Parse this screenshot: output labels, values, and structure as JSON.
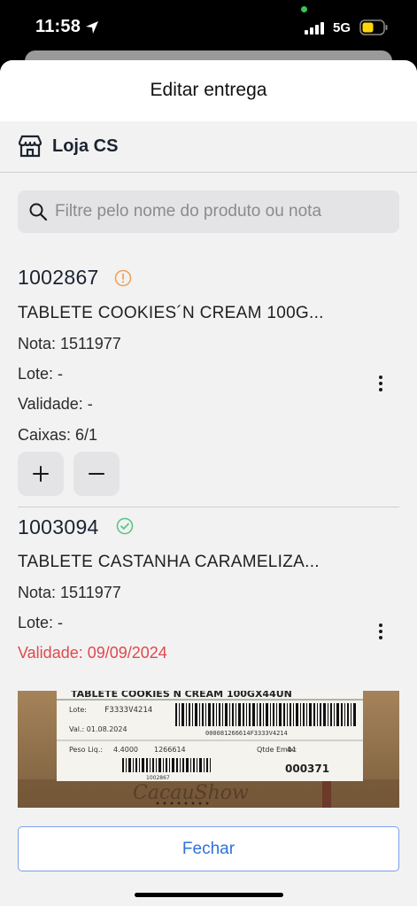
{
  "status_bar": {
    "time": "11:58",
    "network": "5G",
    "battery_color": "#ffd60a"
  },
  "sheet": {
    "title": "Editar entrega"
  },
  "store": {
    "name": "Loja CS",
    "icon": "store-icon"
  },
  "search": {
    "placeholder": "Filtre pelo nome do produto ou nota",
    "value": ""
  },
  "items": [
    {
      "code": "1002867",
      "status": "warning",
      "status_color": "#f0a15a",
      "name": "TABLETE COOKIES´N CREAM 100G...",
      "nota": "Nota: 1511977",
      "lote": "Lote: -",
      "validade": "Validade: -",
      "caixas": "Caixas: 6/1"
    },
    {
      "code": "1003094",
      "status": "ok",
      "status_color": "#5cc48a",
      "name": "TABLETE CASTANHA CARAMELIZA...",
      "nota": "Nota: 1511977",
      "lote": "Lote: -",
      "validade": "Validade: 09/09/2024",
      "validade_color": "#e0484d"
    }
  ],
  "photo_label": {
    "header": "TABLETE COOKIES N CREAM 100GX44UN",
    "lote": "Lote:",
    "lote_value": "F3333V4214",
    "val": "Val.: 01.08.2024",
    "barcode_text": "000081266614F3333V4214",
    "peso": "Peso Liq.:",
    "peso_value": "4.4000",
    "peso_code": "1266614",
    "qtde": "Qtde Emb.:",
    "qtde_value": "44",
    "serial": "000371",
    "small_code": "1002867",
    "brand": "CacauShow"
  },
  "footer": {
    "close_label": "Fechar"
  }
}
